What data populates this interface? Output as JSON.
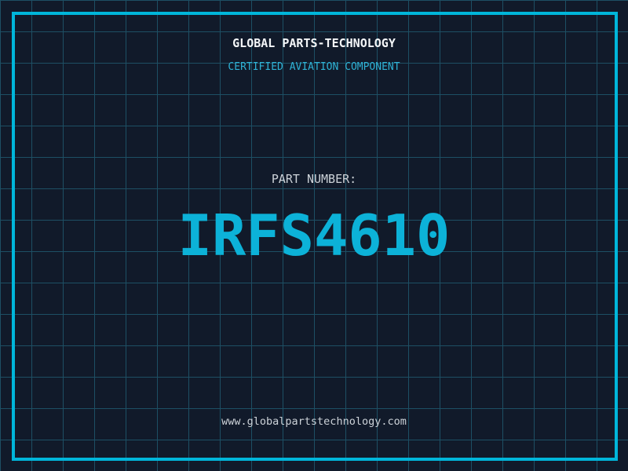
{
  "header": {
    "company": "GLOBAL PARTS-TECHNOLOGY",
    "certification": "CERTIFIED AVIATION COMPONENT"
  },
  "part": {
    "label": "PART NUMBER:",
    "number": "IRFS4610"
  },
  "footer": {
    "website": "www.globalpartstechnology.com"
  },
  "colors": {
    "background": "#111a2a",
    "grid_line": "#1d4f64",
    "frame": "#00b6da",
    "accent_cyan": "#0cb2d8",
    "accent_cyan_soft": "#2fb3d6",
    "text_white": "#f4f6f8",
    "text_light": "#ccd2d8"
  }
}
